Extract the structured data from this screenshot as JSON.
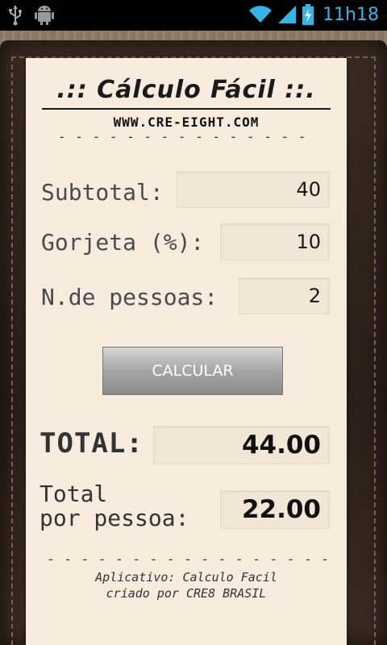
{
  "status_bar": {
    "time": "11h18",
    "icons": [
      "usb-icon",
      "android-icon",
      "wifi-icon",
      "signal-icon",
      "battery-icon"
    ],
    "accent": "#33b5e5"
  },
  "receipt": {
    "title": ".:: Cálculo Fácil ::.",
    "url": "WWW.CRE-EIGHT.COM",
    "divider": "- - - - - - - - - - - - - - - -",
    "subtotal_label": "Subtotal:",
    "subtotal_value": "40",
    "gorjeta_label": "Gorjeta (%):",
    "gorjeta_value": "10",
    "pessoas_label": "N.de pessoas:",
    "pessoas_value": "2",
    "button_label": "CALCULAR",
    "total_label": "TOTAL:",
    "total_value": "44.00",
    "per_person_label_line1": "Total",
    "per_person_label_line2": "por pessoa:",
    "per_person_value": "22.00",
    "footer_divider": "- - - - - - - - - - - - - - - - - - - - -",
    "footer_line1": "Aplicativo: Calculo Facil",
    "footer_line2": "criado por CRE8 BRASIL"
  }
}
